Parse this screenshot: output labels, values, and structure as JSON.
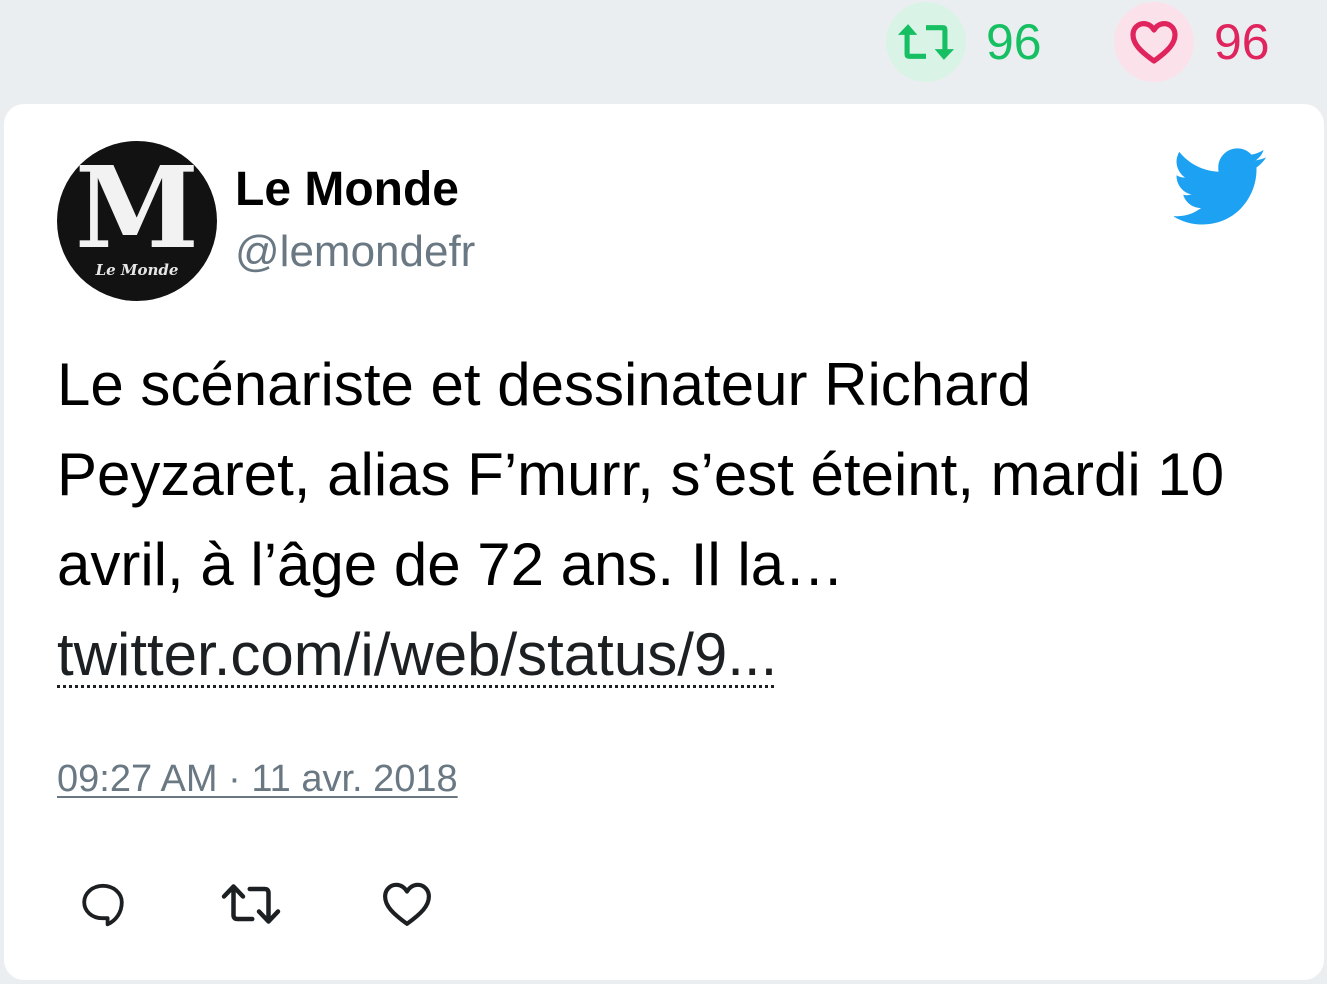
{
  "stats": {
    "retweet_count": "96",
    "like_count": "96",
    "retweet_color": "#17bf63",
    "like_color": "#e0245e",
    "retweet_icon": "retweet-icon",
    "like_icon": "heart-icon"
  },
  "tweet": {
    "author": {
      "name": "Le Monde",
      "handle": "@lemondefr",
      "avatar": {
        "monogram": "M",
        "caption": "Le Monde"
      }
    },
    "brand_icon": "twitter-bird-icon",
    "brand_color": "#1da1f2",
    "text": "Le scénariste et dessinateur Richard Peyzaret, alias F’murr, s’est éteint, mardi 10 avril, à l’âge de 72 ans. Il la…",
    "link": "twitter.com/i/web/status/9...",
    "timestamp": "09:27 AM · 11 avr. 2018",
    "actions": [
      {
        "name": "reply",
        "icon": "reply-icon"
      },
      {
        "name": "retweet",
        "icon": "retweet-icon"
      },
      {
        "name": "like",
        "icon": "heart-icon"
      }
    ]
  }
}
